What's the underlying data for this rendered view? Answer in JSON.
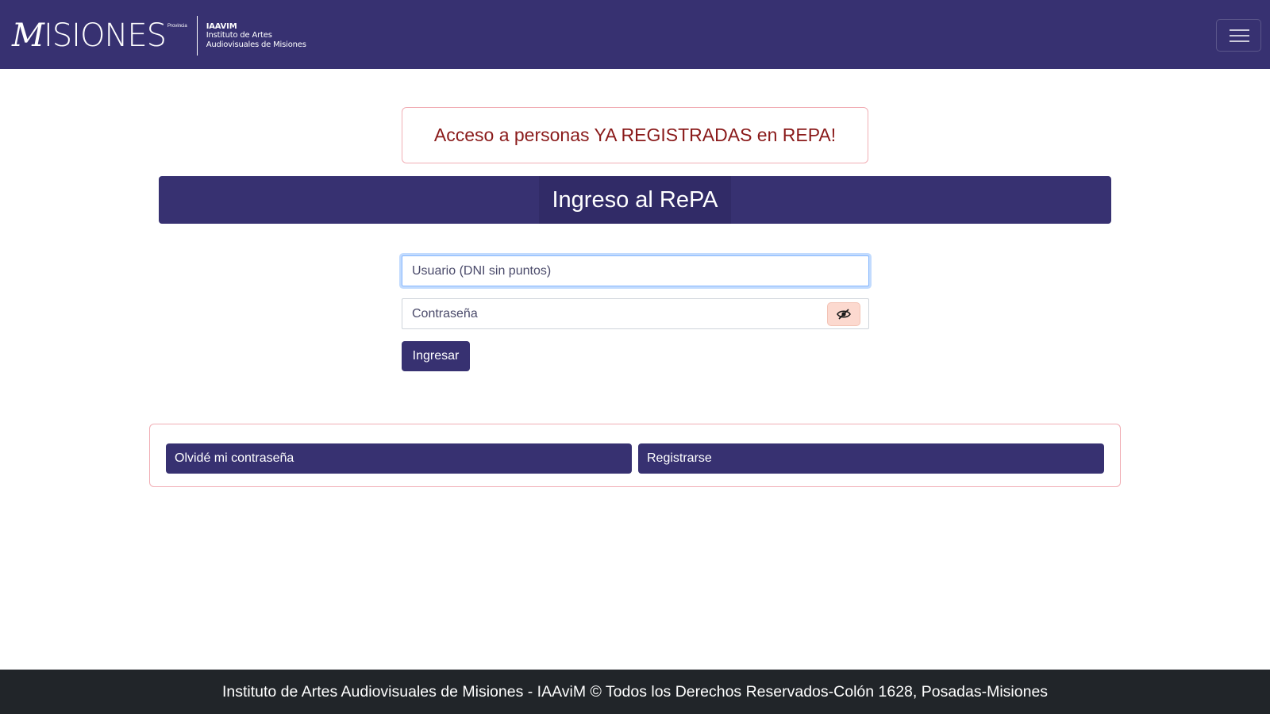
{
  "header": {
    "brand_word_initial": "M",
    "brand_word_rest": "ISIONES",
    "brand_superscript": "Provincia",
    "brand_acronym": "IAAVIM",
    "brand_line1": "Instituto de Artes",
    "brand_line2": "Audiovisuales de Misiones",
    "menu_icon": "hamburger-menu-icon"
  },
  "alert": {
    "text": "Acceso a personas YA REGISTRADAS en REPA!"
  },
  "login": {
    "title": "Ingreso al RePA",
    "username_placeholder": "Usuario (DNI sin puntos)",
    "username_value": "",
    "password_placeholder": "Contraseña",
    "password_value": "",
    "toggle_icon": "eye-slash-icon",
    "submit_label": "Ingresar"
  },
  "links": {
    "forgot_label": "Olvidé mi contraseña",
    "register_label": "Registrarse"
  },
  "footer": {
    "text": "Instituto de Artes Audiovisuales de Misiones - IAAviM © Todos los Derechos Reservados-Colón 1628, Posadas-Misiones"
  },
  "colors": {
    "primary": "#373171",
    "footer_bg": "#212529",
    "alert_text": "#8a1a1a",
    "alert_border": "#f1aeb5",
    "eye_button_bg": "#fcd9cf"
  }
}
